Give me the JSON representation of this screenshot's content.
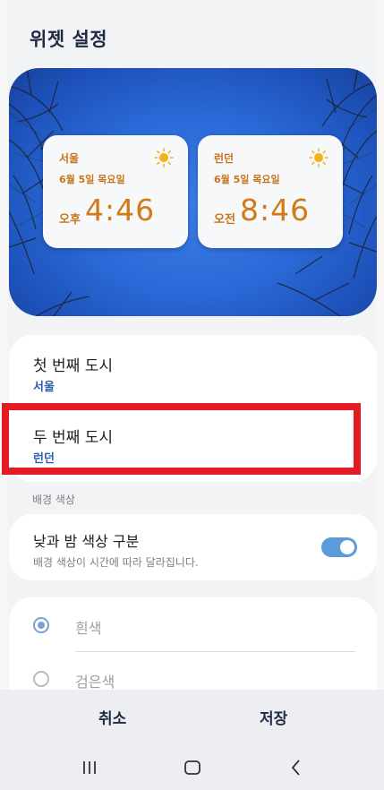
{
  "header": {
    "title": "위젯 설정"
  },
  "preview": {
    "widgets": [
      {
        "city": "서울",
        "date": "6월 5일 목요일",
        "ampm": "오후",
        "time": "4:46"
      },
      {
        "city": "런던",
        "date": "6월 5일 목요일",
        "ampm": "오전",
        "time": "8:46"
      }
    ]
  },
  "cities": {
    "first": {
      "label": "첫 번째 도시",
      "value": "서울"
    },
    "second": {
      "label": "두 번째 도시",
      "value": "런던"
    }
  },
  "background": {
    "section_label": "배경 색상",
    "daynight": {
      "label": "낮과 밤 색상 구분",
      "desc": "배경 색상이 시간에 따라 달라집니다.",
      "enabled": true
    },
    "options": [
      {
        "label": "흰색",
        "selected": true
      },
      {
        "label": "검은색",
        "selected": false
      }
    ]
  },
  "actions": {
    "cancel": "취소",
    "save": "저장"
  },
  "colors": {
    "accent": "#2d5fa8",
    "time": "#d17a16",
    "highlight": "#e31b22",
    "toggle": "#5b9bd8"
  },
  "navbar": {
    "icons": [
      "recents-icon",
      "home-icon",
      "back-icon"
    ]
  }
}
